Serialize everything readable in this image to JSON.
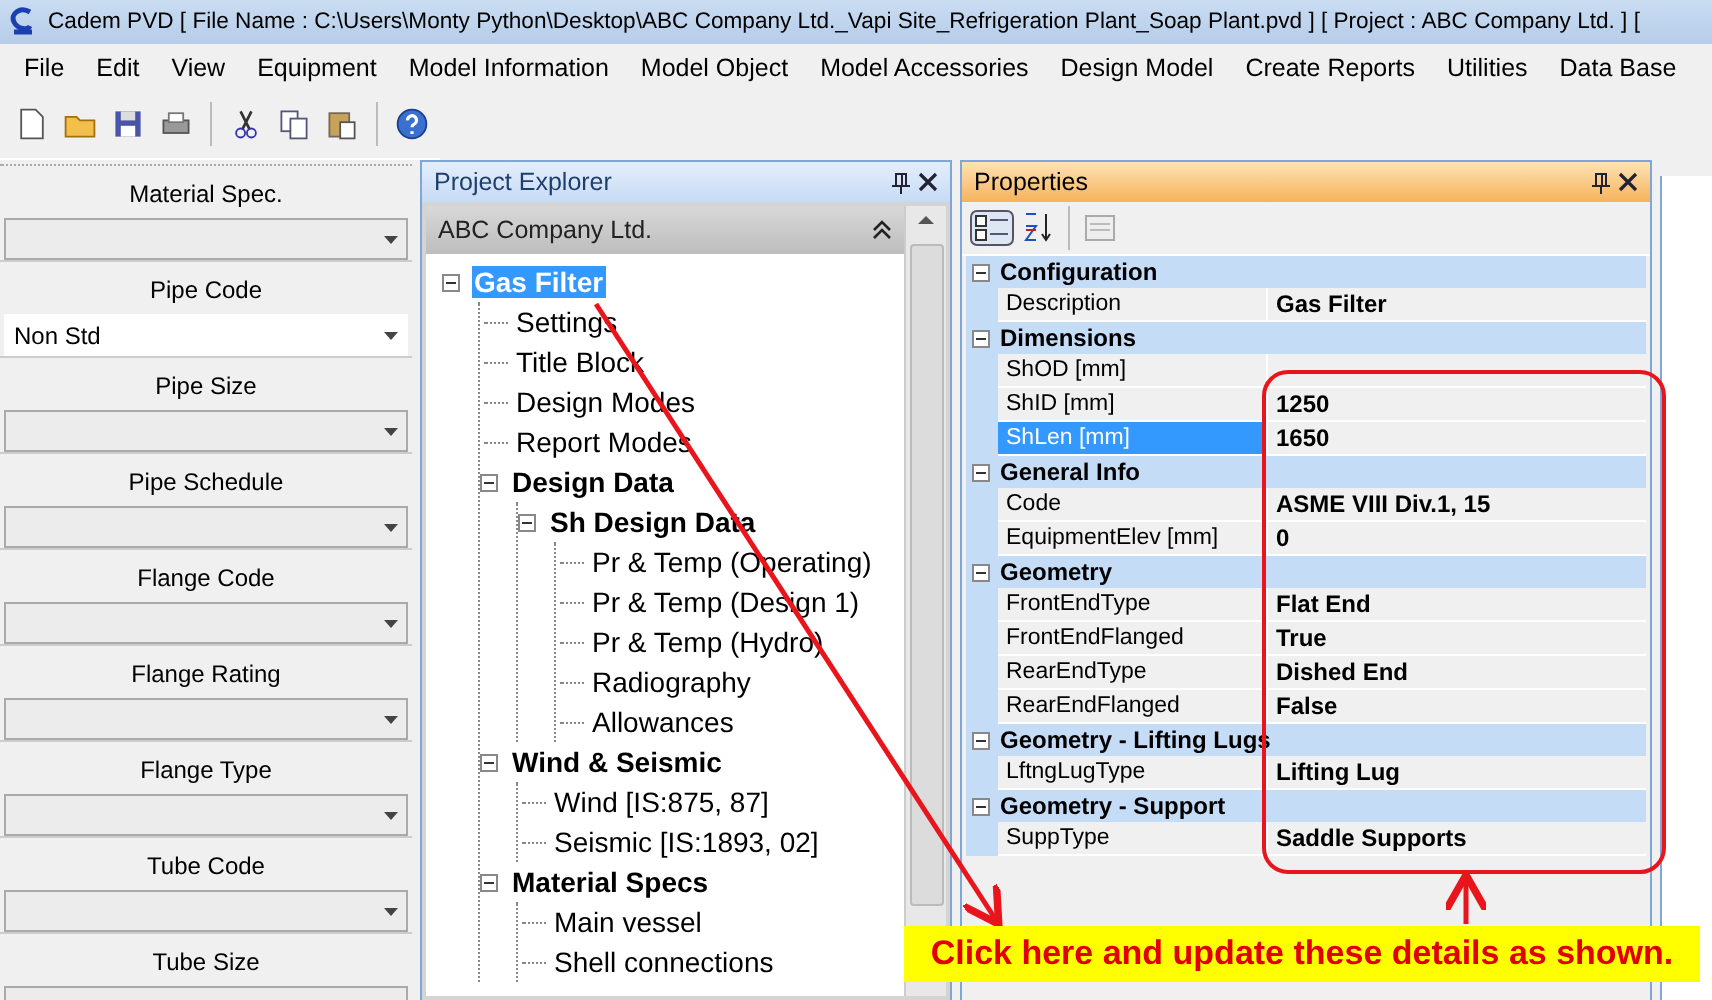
{
  "window": {
    "title": "Cadem PVD [ File Name : C:\\Users\\Monty Python\\Desktop\\ABC Company Ltd._Vapi Site_Refrigeration Plant_Soap Plant.pvd ] [ Project : ABC Company Ltd. ] ["
  },
  "menu": [
    "File",
    "Edit",
    "View",
    "Equipment",
    "Model Information",
    "Model Object",
    "Model Accessories",
    "Design Model",
    "Create Reports",
    "Utilities",
    "Data Base"
  ],
  "left_panel": {
    "fields": [
      {
        "label": "Material Spec."
      },
      {
        "label": "Pipe Code",
        "value": "Non Std"
      },
      {
        "label": "Pipe Size"
      },
      {
        "label": "Pipe Schedule"
      },
      {
        "label": "Flange Code"
      },
      {
        "label": "Flange Rating"
      },
      {
        "label": "Flange Type"
      },
      {
        "label": "Tube Code"
      },
      {
        "label": "Tube Size"
      }
    ]
  },
  "project_explorer": {
    "title": "Project Explorer",
    "header": "ABC Company Ltd.",
    "tree": [
      {
        "label": "Gas Filter",
        "selected": true,
        "expanded": true,
        "children": [
          {
            "label": "Settings",
            "selected": false
          },
          {
            "label": "Title Block",
            "selected": false
          },
          {
            "label": "Design Modes",
            "selected": false
          },
          {
            "label": "Report Modes",
            "selected": false
          },
          {
            "label": "Design Data",
            "selected": false,
            "expanded": true,
            "children": [
              {
                "label": "Sh Design Data",
                "selected": false,
                "expanded": true,
                "children": [
                  {
                    "label": "Pr & Temp (Operating)",
                    "selected": false
                  },
                  {
                    "label": "Pr & Temp (Design 1)",
                    "selected": false
                  },
                  {
                    "label": "Pr & Temp (Hydro)",
                    "selected": false
                  },
                  {
                    "label": "Radiography",
                    "selected": false
                  },
                  {
                    "label": "Allowances",
                    "selected": false
                  }
                ]
              }
            ]
          },
          {
            "label": "Wind & Seismic",
            "selected": false,
            "expanded": true,
            "children": [
              {
                "label": "Wind [IS:875, 87]",
                "selected": false
              },
              {
                "label": "Seismic [IS:1893, 02]",
                "selected": false
              }
            ]
          },
          {
            "label": "Material Specs",
            "selected": false,
            "expanded": true,
            "children": [
              {
                "label": "Main vessel",
                "selected": false
              },
              {
                "label": "Shell connections",
                "selected": false
              }
            ]
          }
        ]
      }
    ]
  },
  "properties": {
    "title": "Properties",
    "categories": [
      {
        "name": "Configuration",
        "expanded": true,
        "rows": [
          {
            "name": "Description",
            "value": "Gas Filter",
            "selected": false
          }
        ]
      },
      {
        "name": "Dimensions",
        "expanded": true,
        "rows": [
          {
            "name": "ShOD [mm]",
            "selected": false
          },
          {
            "name": "ShID [mm]",
            "value": "1250",
            "selected": false
          },
          {
            "name": "ShLen [mm]",
            "value": "1650",
            "selected": true
          }
        ]
      },
      {
        "name": "General Info",
        "expanded": true,
        "rows": [
          {
            "name": "Code",
            "value": "ASME VIII Div.1, 15",
            "selected": false
          },
          {
            "name": "EquipmentElev [mm]",
            "value": "0",
            "selected": false
          }
        ]
      },
      {
        "name": "Geometry",
        "expanded": true,
        "rows": [
          {
            "name": "FrontEndType",
            "value": "Flat End",
            "selected": false
          },
          {
            "name": "FrontEndFlanged",
            "value": "True",
            "selected": false
          },
          {
            "name": "RearEndType",
            "value": "Dished End",
            "selected": false
          },
          {
            "name": "RearEndFlanged",
            "value": "False",
            "selected": false
          }
        ]
      },
      {
        "name": "Geometry - Lifting Lugs",
        "expanded": true,
        "rows": [
          {
            "name": "LftngLugType",
            "value": "Lifting Lug",
            "selected": false
          }
        ]
      },
      {
        "name": "Geometry - Support",
        "expanded": true,
        "rows": [
          {
            "name": "SuppType",
            "value": "Saddle Supports",
            "selected": false
          }
        ]
      }
    ]
  },
  "annotation": {
    "text": "Click here and update these details as shown."
  }
}
